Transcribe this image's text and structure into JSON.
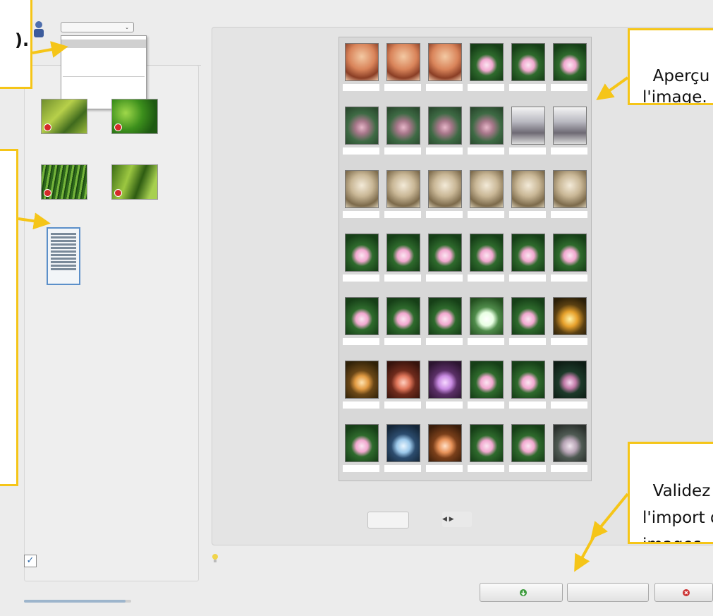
{
  "left": {
    "profile_select": "",
    "dropdown_items": [
      "",
      "",
      "",
      "",
      ""
    ],
    "group_label": "",
    "quality_label": "",
    "checkbox_label": "",
    "quality_level": 0.95
  },
  "preview": {
    "label": "",
    "page_name": "",
    "pager": "",
    "nav": "◀ ▶",
    "rows": [
      {
        "img": [
          "woman",
          "woman",
          "woman",
          "lotus",
          "lotus",
          "lotus"
        ],
        "caps": [
          "",
          "",
          "",
          "",
          "",
          ""
        ]
      },
      {
        "img": [
          "blur",
          "blur",
          "blur",
          "blur",
          "snow",
          "snow"
        ],
        "caps": [
          "",
          "",
          "",
          "",
          "",
          ""
        ]
      },
      {
        "img": [
          "sepia",
          "sepia",
          "sepia",
          "sepia",
          "sepia",
          "sepia"
        ],
        "caps": [
          "",
          "",
          "",
          "",
          "",
          ""
        ]
      },
      {
        "img": [
          "lotus",
          "lotus",
          "lotus",
          "lotus",
          "lotus",
          "lotus"
        ],
        "caps": [
          "",
          "",
          "",
          "",
          "",
          ""
        ]
      },
      {
        "img": [
          "lotus",
          "lotus",
          "lotus",
          "lotusbright",
          "lotus",
          "lotusgold"
        ],
        "caps": [
          "",
          "",
          "",
          "",
          "",
          ""
        ]
      },
      {
        "img": [
          "lotuswarm",
          "lotusred",
          "lotuspurple",
          "lotus",
          "lotus",
          "lotusdark"
        ],
        "caps": [
          "",
          "",
          "",
          "",
          "",
          ""
        ]
      },
      {
        "img": [
          "lotus",
          "lotusblue",
          "lotusorange",
          "lotus",
          "lotus",
          "lotusgrey"
        ],
        "caps": [
          "",
          "",
          "",
          "",
          "",
          ""
        ]
      }
    ]
  },
  "callouts": {
    "left_top": "",
    "left_mid": "",
    "preview_text": "Aperçu de\nl'image.",
    "validate_text": "Validez\nl'import des\nimages."
  },
  "bottom": {
    "hint": "",
    "btn_import": "",
    "btn_middle": "",
    "btn_cancel": ""
  },
  "colors": {
    "accent": "#f5c518",
    "red": "#d42a2a",
    "green": "#3a9a3a"
  }
}
